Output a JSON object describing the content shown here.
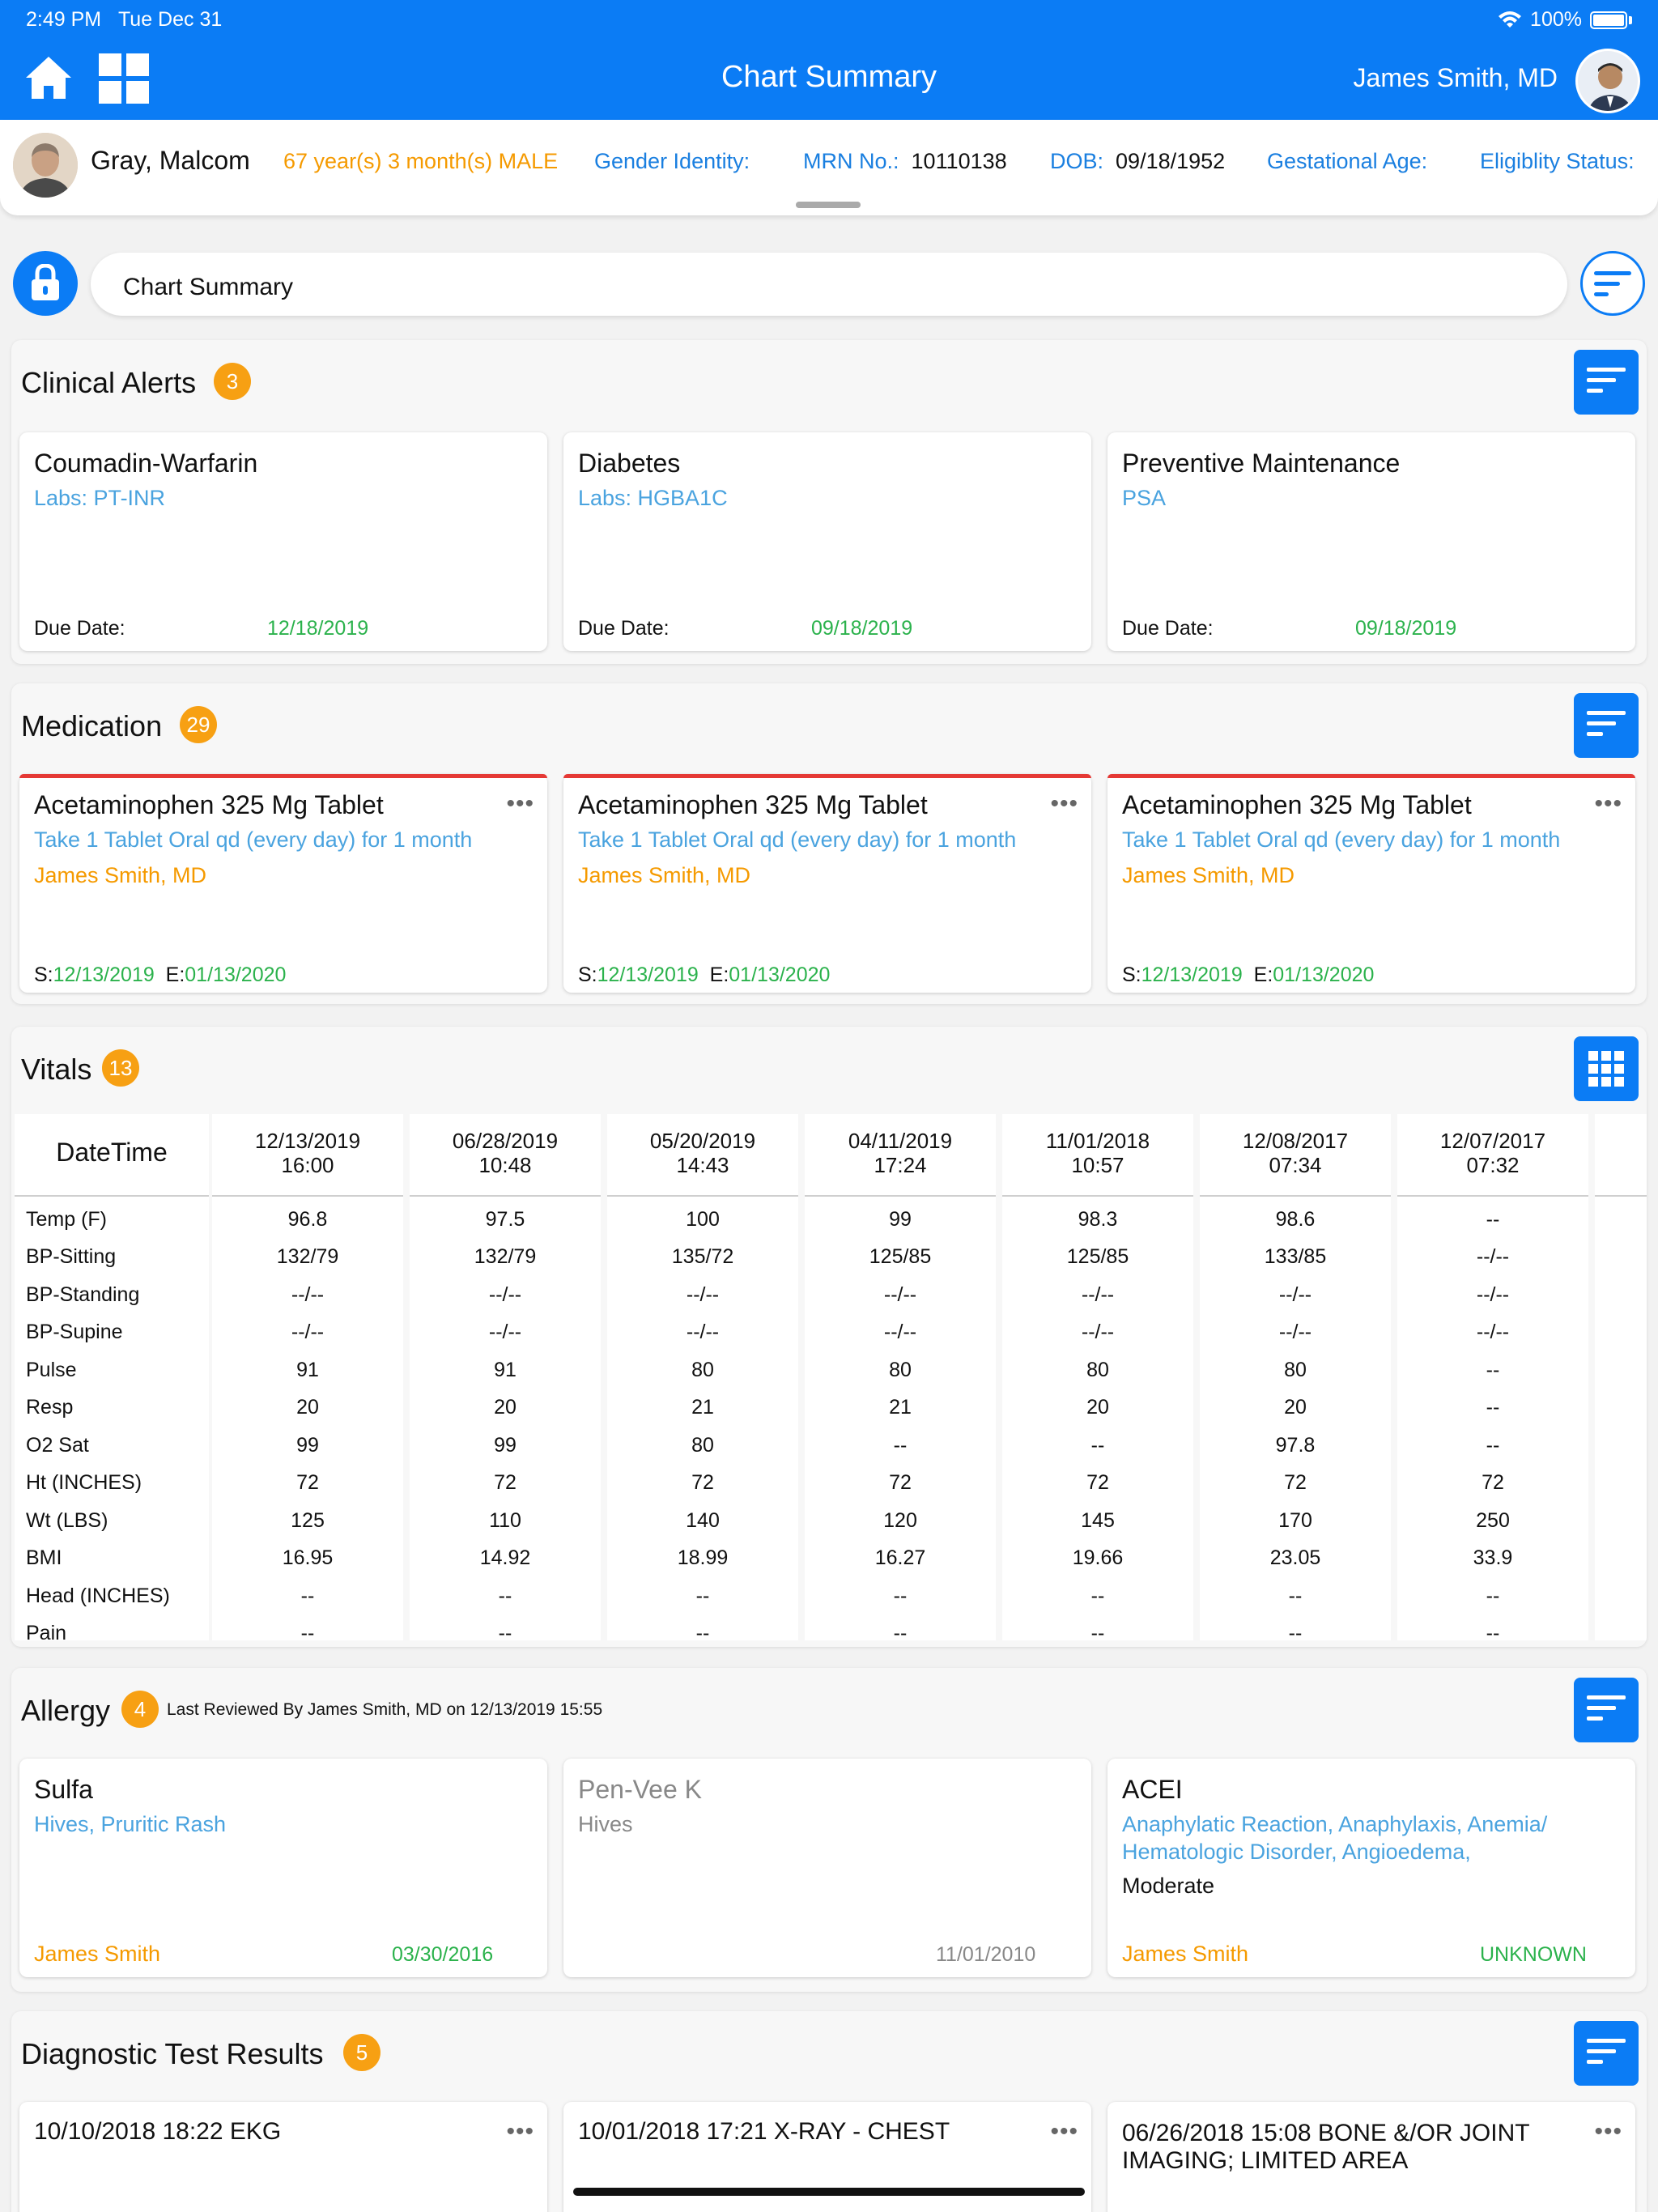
{
  "status": {
    "time": "2:49 PM",
    "date": "Tue Dec 31",
    "battery": "100%"
  },
  "header": {
    "title": "Chart Summary",
    "doctor": "James Smith, MD"
  },
  "patient": {
    "name": "Gray, Malcom",
    "age_sex": "67 year(s) 3 month(s) MALE",
    "gender_identity_label": "Gender Identity:",
    "mrn_label": "MRN No.:",
    "mrn": "10110138",
    "dob_label": "DOB:",
    "dob": "09/18/1952",
    "gestational_label": "Gestational Age:",
    "eligibility_label": "Eligiblity Status:"
  },
  "search": {
    "value": "Chart Summary"
  },
  "clinical_alerts": {
    "title": "Clinical Alerts",
    "count": "3",
    "due_label": "Due Date:",
    "cards": [
      {
        "title": "Coumadin-Warfarin",
        "sub": "Labs: PT-INR",
        "due": "12/18/2019"
      },
      {
        "title": "Diabetes",
        "sub": "Labs: HGBA1C",
        "due": "09/18/2019"
      },
      {
        "title": "Preventive Maintenance",
        "sub": "PSA",
        "due": "09/18/2019"
      }
    ]
  },
  "medication": {
    "title": "Medication",
    "count": "29",
    "start_label": "S:",
    "end_label": "E:",
    "cards": [
      {
        "title": "Acetaminophen 325 Mg Tablet",
        "sig": "Take 1 Tablet Oral qd (every day)  for 1 month",
        "prescriber": "James Smith, MD",
        "start": "12/13/2019",
        "end": "01/13/2020"
      },
      {
        "title": "Acetaminophen 325 Mg Tablet",
        "sig": "Take 1 Tablet Oral qd (every day)  for 1 month",
        "prescriber": "James Smith, MD",
        "start": "12/13/2019",
        "end": "01/13/2020"
      },
      {
        "title": "Acetaminophen 325 Mg Tablet",
        "sig": "Take 1 Tablet Oral qd (every day)  for 1 month",
        "prescriber": "James Smith, MD",
        "start": "12/13/2019",
        "end": "01/13/2020"
      }
    ]
  },
  "vitals": {
    "title": "Vitals",
    "count": "13",
    "header_label": "DateTime",
    "row_labels": [
      "Temp (F)",
      "BP-Sitting",
      "BP-Standing",
      "BP-Supine",
      "Pulse",
      "Resp",
      "O2 Sat",
      "Ht (INCHES)",
      "Wt (LBS)",
      "BMI",
      "Head (INCHES)",
      "Pain"
    ],
    "columns": [
      {
        "date": "12/13/2019",
        "time": "16:00",
        "values": [
          "96.8",
          "132/79",
          "--/--",
          "--/--",
          "91",
          "20",
          "99",
          "72",
          "125",
          "16.95",
          "--",
          "--"
        ]
      },
      {
        "date": "06/28/2019",
        "time": "10:48",
        "values": [
          "97.5",
          "132/79",
          "--/--",
          "--/--",
          "91",
          "20",
          "99",
          "72",
          "110",
          "14.92",
          "--",
          "--"
        ]
      },
      {
        "date": "05/20/2019",
        "time": "14:43",
        "values": [
          "100",
          "135/72",
          "--/--",
          "--/--",
          "80",
          "21",
          "80",
          "72",
          "140",
          "18.99",
          "--",
          "--"
        ]
      },
      {
        "date": "04/11/2019",
        "time": "17:24",
        "values": [
          "99",
          "125/85",
          "--/--",
          "--/--",
          "80",
          "21",
          "--",
          "72",
          "120",
          "16.27",
          "--",
          "--"
        ]
      },
      {
        "date": "11/01/2018",
        "time": "10:57",
        "values": [
          "98.3",
          "125/85",
          "--/--",
          "--/--",
          "80",
          "20",
          "--",
          "72",
          "145",
          "19.66",
          "--",
          "--"
        ]
      },
      {
        "date": "12/08/2017",
        "time": "07:34",
        "values": [
          "98.6",
          "133/85",
          "--/--",
          "--/--",
          "80",
          "20",
          "97.8",
          "72",
          "170",
          "23.05",
          "--",
          "--"
        ]
      },
      {
        "date": "12/07/2017",
        "time": "07:32",
        "values": [
          "--",
          "--/--",
          "--/--",
          "--/--",
          "--",
          "--",
          "--",
          "72",
          "250",
          "33.9",
          "--",
          "--"
        ]
      }
    ],
    "partial_header": "1"
  },
  "allergy": {
    "title": "Allergy",
    "count": "4",
    "reviewed": "Last Reviewed By James Smith, MD on 12/13/2019 15:55",
    "cards": [
      {
        "title": "Sulfa",
        "reaction": "Hives, Pruritic Rash",
        "by": "James Smith",
        "date": "03/30/2016"
      },
      {
        "title": "Pen-Vee K",
        "reaction": "Hives",
        "date": "11/01/2010"
      },
      {
        "title": "ACEI",
        "reaction_1": "Anaphylatic Reaction, Anaphylaxis, Anemia/",
        "reaction_2": "Hematologic Disorder, Angioedema,",
        "severity": "Moderate",
        "by": "James Smith",
        "status": "UNKNOWN"
      }
    ]
  },
  "diagnostic": {
    "title": "Diagnostic Test Results",
    "count": "5",
    "cards": [
      {
        "title": "10/10/2018 18:22 EKG"
      },
      {
        "title": "10/01/2018 17:21 X-RAY - CHEST"
      },
      {
        "title_1": "06/26/2018 15:08 BONE &/OR JOINT",
        "title_2": "IMAGING; LIMITED AREA"
      }
    ]
  },
  "colors": {
    "primary": "#0b7cf5",
    "badge": "#f7a013",
    "date_green": "#2bb24c",
    "orange_text": "#f59a00",
    "link_blue": "#4aa3df",
    "alert_red": "#e53935"
  }
}
